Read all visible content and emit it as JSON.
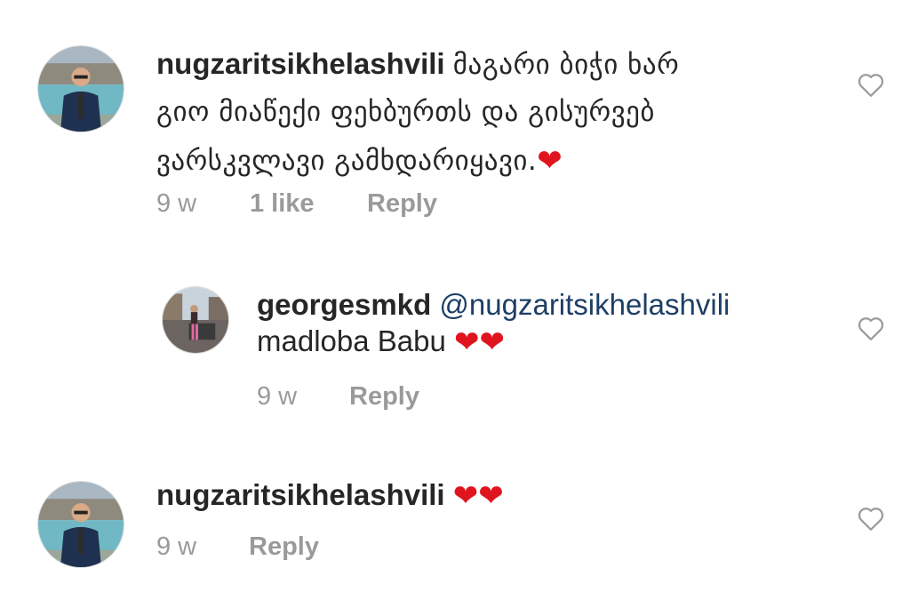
{
  "comments": [
    {
      "username": "nugzaritsikhelashvili",
      "line1": "მაგარი ბიჭი ხარ",
      "line2": "გიო მიაწექი ფეხბურთს და გისურვებ",
      "line3": "ვარსკვლავი გამხდარიყავი.",
      "hearts": "❤",
      "time": "9 w",
      "likes": "1 like",
      "reply_label": "Reply",
      "like_icon": "heart-outline-icon"
    },
    {
      "username": "georgesmkd",
      "mention": "@nugzaritsikhelashvili",
      "text": "madloba Babu",
      "hearts": "❤❤",
      "time": "9 w",
      "reply_label": "Reply",
      "like_icon": "heart-outline-icon"
    },
    {
      "username": "nugzaritsikhelashvili",
      "hearts": "❤❤",
      "time": "9 w",
      "reply_label": "Reply",
      "like_icon": "heart-outline-icon"
    }
  ],
  "colors": {
    "text": "#262626",
    "meta": "#9a9a9a",
    "mention": "#1d3f66",
    "heart": "#e0141e"
  }
}
